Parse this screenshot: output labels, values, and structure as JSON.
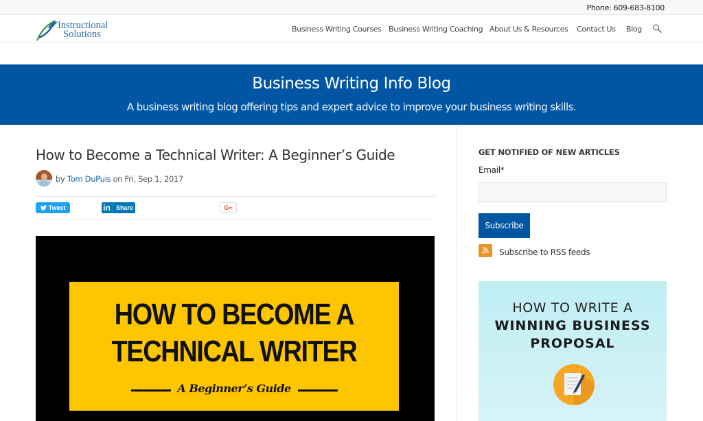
{
  "topbar": {
    "phone": "Phone: 609-683-8100"
  },
  "header": {
    "logo": {
      "line1": "Instructional",
      "line2": "Solutions",
      "icon": "leaf-swoosh-logo-icon"
    },
    "nav": [
      {
        "label": "Business Writing Courses"
      },
      {
        "label": "Business Writing Coaching"
      },
      {
        "label": "About Us & Resources"
      },
      {
        "label": "Contact Us"
      },
      {
        "label": "Blog"
      }
    ],
    "search_icon": "search-icon"
  },
  "banner": {
    "title": "Business Writing Info Blog",
    "subtitle": "A business writing blog offering tips and expert advice to improve your business writing skills."
  },
  "post": {
    "title": "How to Become a Technical Writer: A Beginner’s Guide",
    "byline_prefix": "by ",
    "author": "Tom DuPuis",
    "date_text": " on Fri, Sep 1, 2017",
    "share": {
      "tweet_label": "Tweet",
      "linkedin_label": "Share",
      "linkedin_glyph": "in",
      "gplus_label": "G+"
    },
    "hero": {
      "line1": "HOW TO BECOME A",
      "line2": "TECHNICAL WRITER",
      "subline": "A Beginner’s Guide"
    }
  },
  "sidebar": {
    "heading": "GET NOTIFIED OF NEW ARTICLES",
    "email_label": "Email*",
    "email_value": "",
    "email_placeholder": "",
    "subscribe_label": "Subscribe",
    "rss_label": "Subscribe to RSS feeds",
    "promo": {
      "line1": "HOW TO WRITE A",
      "line2": "WINNING BUSINESS",
      "line3": "PROPOSAL"
    }
  },
  "colors": {
    "brand_blue": "#0156a3",
    "link_blue": "#1b64ad",
    "twitter": "#1da1f2",
    "linkedin": "#0077b5",
    "gplus": "#dd4b39",
    "rss": "#e8962b",
    "hero_yellow": "#fec600"
  }
}
